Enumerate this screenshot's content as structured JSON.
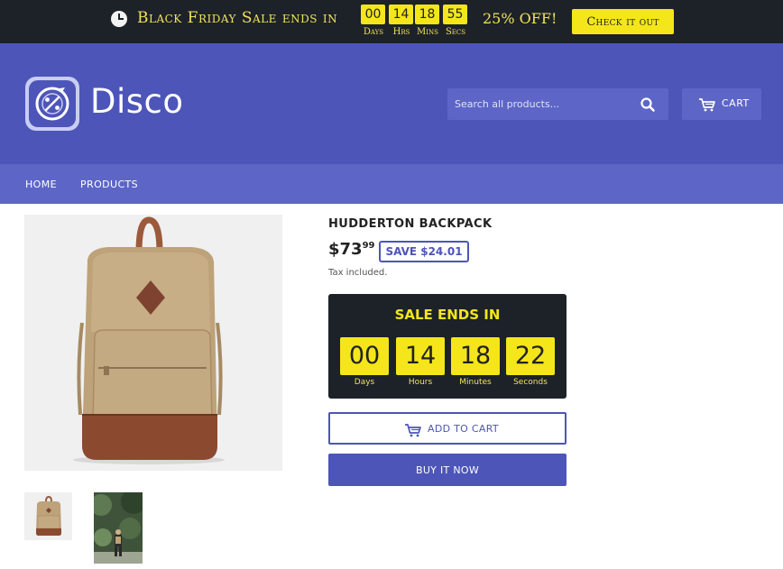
{
  "promo": {
    "title": "Black Friday Sale ends in",
    "timer": [
      {
        "value": "00",
        "label": "Days"
      },
      {
        "value": "14",
        "label": "Hrs"
      },
      {
        "value": "18",
        "label": "Mins"
      },
      {
        "value": "55",
        "label": "Secs"
      }
    ],
    "discount": "25% OFF!",
    "cta_label": "Check it out",
    "icon": "clock-icon"
  },
  "header": {
    "brand": "Disco",
    "logo_icon": "percent-dial-icon",
    "search": {
      "placeholder": "Search all products...",
      "icon": "search-icon"
    },
    "cart_label": "CART",
    "cart_icon": "cart-icon"
  },
  "nav": {
    "items": [
      {
        "label": "HOME"
      },
      {
        "label": "PRODUCTS"
      }
    ]
  },
  "product": {
    "title": "HUDDERTON BACKPACK",
    "price_main": "$73",
    "price_cents": "99",
    "save": "SAVE $24.01",
    "tax_note": "Tax included.",
    "sale_timer": {
      "title": "SALE ENDS IN",
      "units": [
        {
          "value": "00",
          "label": "Days"
        },
        {
          "value": "14",
          "label": "Hours"
        },
        {
          "value": "18",
          "label": "Minutes"
        },
        {
          "value": "22",
          "label": "Seconds"
        }
      ]
    },
    "add_to_cart": "ADD TO CART",
    "buy_now": "BUY IT NOW"
  },
  "colors": {
    "primary": "#4d55b8",
    "nav": "#5d66c6",
    "promo_bg": "#1c2228",
    "accent_yellow": "#f4e61a"
  }
}
